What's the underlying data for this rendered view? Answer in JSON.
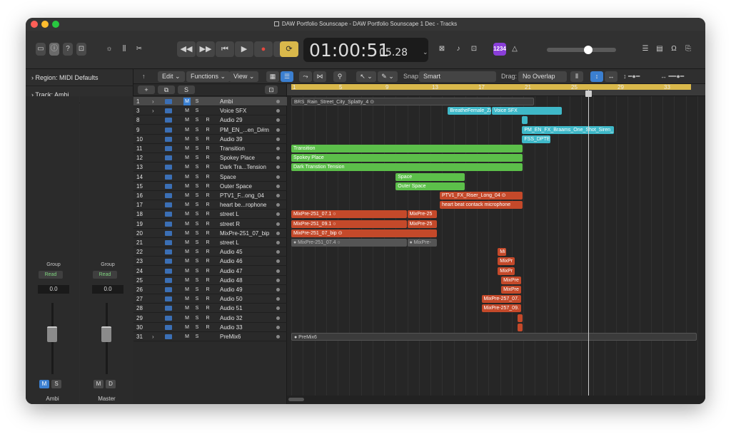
{
  "window": {
    "title": "DAW Portfolio Sounscape - DAW Portfolio Sounscape 1 Dec - Tracks"
  },
  "control_bar": {
    "left_icons": [
      "library-icon",
      "info-icon",
      "help-icon",
      "save-icon",
      "brightness-icon",
      "mixer-icon",
      "scissors-icon"
    ],
    "transport": [
      "rewind-icon",
      "fast-forward-icon",
      "go-to-start-icon",
      "play-icon",
      "record-icon",
      "capture-record-icon",
      "cycle-icon"
    ],
    "lcd_main": "01:00:51",
    "lcd_sub": "05.28",
    "lcd_chevron": "⌄",
    "right_icons": [
      "replace-icon",
      "tuner-icon",
      "count-in-icon",
      "signature-icon",
      "metronome-icon"
    ],
    "signature_label": "1234",
    "volume_level": 0.6,
    "far_right_icons": [
      "list-icon",
      "notepad-icon",
      "loops-icon",
      "browser-icon"
    ]
  },
  "inspector": {
    "region_label": "Region: MIDI Defaults",
    "track_label": "Track: Ambi",
    "strips": [
      {
        "group": "Group",
        "read": "Read",
        "volume": "0.0",
        "btn1": "M",
        "btn2": "S",
        "name": "Ambi"
      },
      {
        "group": "Group",
        "read": "Read",
        "volume": "0.0",
        "btn1": "M",
        "btn2": "D",
        "name": "Master"
      }
    ]
  },
  "menubar": {
    "edit": "Edit",
    "functions": "Functions",
    "view": "View",
    "snap_label": "Snap:",
    "snap_value": "Smart",
    "drag_label": "Drag:",
    "drag_value": "No Overlap"
  },
  "track_tools": {
    "add": "+",
    "s": "S"
  },
  "ruler": {
    "bars": [
      "1",
      "5",
      "9",
      "13",
      "17",
      "21",
      "25",
      "29",
      "33"
    ]
  },
  "tracks": [
    {
      "num": "1",
      "name": "Ambi",
      "chev": "›",
      "r": "",
      "sel": true
    },
    {
      "num": "3",
      "name": "Voice SFX",
      "chev": "›",
      "r": "",
      "sel": false
    },
    {
      "num": "8",
      "name": "Audio 29",
      "chev": "",
      "r": "R",
      "sel": false
    },
    {
      "num": "9",
      "name": "PM_EN_...en_D#m",
      "chev": "",
      "r": "R",
      "sel": false
    },
    {
      "num": "10",
      "name": "Audio 39",
      "chev": "",
      "r": "R",
      "sel": false
    },
    {
      "num": "11",
      "name": "Transition",
      "chev": "",
      "r": "R",
      "sel": false
    },
    {
      "num": "12",
      "name": "Spokey Place",
      "chev": "",
      "r": "R",
      "sel": false
    },
    {
      "num": "13",
      "name": "Dark Tra...Tension",
      "chev": "",
      "r": "R",
      "sel": false
    },
    {
      "num": "14",
      "name": "Space",
      "chev": "",
      "r": "R",
      "sel": false
    },
    {
      "num": "15",
      "name": "Outer Space",
      "chev": "",
      "r": "R",
      "sel": false
    },
    {
      "num": "16",
      "name": "PTV1_F...ong_04",
      "chev": "",
      "r": "R",
      "sel": false
    },
    {
      "num": "17",
      "name": "heart be...rophone",
      "chev": "",
      "r": "R",
      "sel": false
    },
    {
      "num": "18",
      "name": "street L",
      "chev": "",
      "r": "R",
      "sel": false
    },
    {
      "num": "19",
      "name": "street R",
      "chev": "",
      "r": "R",
      "sel": false
    },
    {
      "num": "20",
      "name": "MixPre-251_07_bip",
      "chev": "",
      "r": "R",
      "sel": false
    },
    {
      "num": "21",
      "name": "street L",
      "chev": "",
      "r": "R",
      "sel": false
    },
    {
      "num": "22",
      "name": "Audio 45",
      "chev": "",
      "r": "R",
      "sel": false
    },
    {
      "num": "23",
      "name": "Audio 46",
      "chev": "",
      "r": "R",
      "sel": false
    },
    {
      "num": "24",
      "name": "Audio 47",
      "chev": "",
      "r": "R",
      "sel": false
    },
    {
      "num": "25",
      "name": "Audio 48",
      "chev": "",
      "r": "R",
      "sel": false
    },
    {
      "num": "26",
      "name": "Audio 49",
      "chev": "",
      "r": "R",
      "sel": false
    },
    {
      "num": "27",
      "name": "Audio 50",
      "chev": "",
      "r": "R",
      "sel": false
    },
    {
      "num": "28",
      "name": "Audio 51",
      "chev": "",
      "r": "R",
      "sel": false
    },
    {
      "num": "29",
      "name": "Audio 32",
      "chev": "",
      "r": "R",
      "sel": false
    },
    {
      "num": "30",
      "name": "Audio 33",
      "chev": "",
      "r": "R",
      "sel": false
    },
    {
      "num": "31",
      "name": "PreMix6",
      "chev": "›",
      "r": "",
      "sel": false
    }
  ],
  "regions": [
    {
      "row": 0,
      "start": 1,
      "end": 22,
      "color": "gray",
      "label": "BRS_Rain_Street_City_Splatty_4 ⊙"
    },
    {
      "row": 1,
      "start": 14.5,
      "end": 18.3,
      "color": "cyan",
      "label": "BreatheFemale_ZA0"
    },
    {
      "row": 1,
      "start": 18.3,
      "end": 24.4,
      "color": "cyan",
      "label": "Voice SFX"
    },
    {
      "row": 2,
      "start": 20.9,
      "end": 21.4,
      "color": "cyan",
      "label": ""
    },
    {
      "row": 3,
      "start": 20.9,
      "end": 28.9,
      "color": "cyan",
      "label": "PM_EN_FX_Braams_One_Shot_Siren_"
    },
    {
      "row": 4,
      "start": 20.9,
      "end": 23.4,
      "color": "cyan",
      "label": "FSS_DPTE"
    },
    {
      "row": 5,
      "start": 1,
      "end": 21,
      "color": "green",
      "label": "Transition"
    },
    {
      "row": 6,
      "start": 1,
      "end": 21,
      "color": "green",
      "label": "Spokey Place"
    },
    {
      "row": 7,
      "start": 1,
      "end": 21,
      "color": "green",
      "label": "Dark Transtion Tension"
    },
    {
      "row": 8,
      "start": 10,
      "end": 16,
      "color": "green",
      "label": "Space"
    },
    {
      "row": 9,
      "start": 10,
      "end": 16,
      "color": "green",
      "label": "Outer Space"
    },
    {
      "row": 10,
      "start": 13.8,
      "end": 21,
      "color": "red",
      "label": "PTV1_FX_Riser_Long_04 ⊙"
    },
    {
      "row": 11,
      "start": 13.8,
      "end": 21,
      "color": "red",
      "label": "heart beat contack microphone"
    },
    {
      "row": 12,
      "start": 1,
      "end": 11,
      "color": "red",
      "label": "MixPre-251_07.1 ○"
    },
    {
      "row": 12,
      "start": 11,
      "end": 13.6,
      "color": "red",
      "label": "MixPre-25"
    },
    {
      "row": 13,
      "start": 1,
      "end": 11,
      "color": "red",
      "label": "MixPre-251_09.1 ○"
    },
    {
      "row": 13,
      "start": 11,
      "end": 13.6,
      "color": "red",
      "label": "MixPre-25"
    },
    {
      "row": 14,
      "start": 1,
      "end": 13.6,
      "color": "red",
      "label": "MixPre-251_07_bip ⊙"
    },
    {
      "row": 15,
      "start": 1,
      "end": 11,
      "color": "dark",
      "label": "● MixPre-251_07.4 ○"
    },
    {
      "row": 15,
      "start": 11,
      "end": 13.6,
      "color": "dark",
      "label": "● MixPre-"
    },
    {
      "row": 16,
      "start": 18.8,
      "end": 19.6,
      "color": "red",
      "label": "Mi"
    },
    {
      "row": 17,
      "start": 18.8,
      "end": 20.3,
      "color": "red",
      "label": "MixPr"
    },
    {
      "row": 18,
      "start": 18.8,
      "end": 20.3,
      "color": "red",
      "label": "MixPr"
    },
    {
      "row": 19,
      "start": 19.1,
      "end": 20.9,
      "color": "red",
      "label": "MixPre"
    },
    {
      "row": 20,
      "start": 19.1,
      "end": 20.9,
      "color": "red",
      "label": "MixPre"
    },
    {
      "row": 21,
      "start": 17.4,
      "end": 20.9,
      "color": "red",
      "label": "MixPre-257_07."
    },
    {
      "row": 22,
      "start": 17.4,
      "end": 20.9,
      "color": "red",
      "label": "MixPre-257_09."
    },
    {
      "row": 23,
      "start": 20.5,
      "end": 21,
      "color": "red",
      "label": ""
    },
    {
      "row": 24,
      "start": 20.5,
      "end": 21,
      "color": "red",
      "label": ""
    },
    {
      "row": 25,
      "start": 1,
      "end": 36,
      "color": "gray",
      "label": "● PreMix6"
    }
  ],
  "playhead_bar": 26.6,
  "colors": {
    "cycle": "#d9b84b",
    "region_cyan": "#3fb8c8",
    "region_green": "#5cbf4a",
    "region_red": "#c4492a",
    "record": "#e5483f",
    "cycle_button": "#d9b84b"
  }
}
